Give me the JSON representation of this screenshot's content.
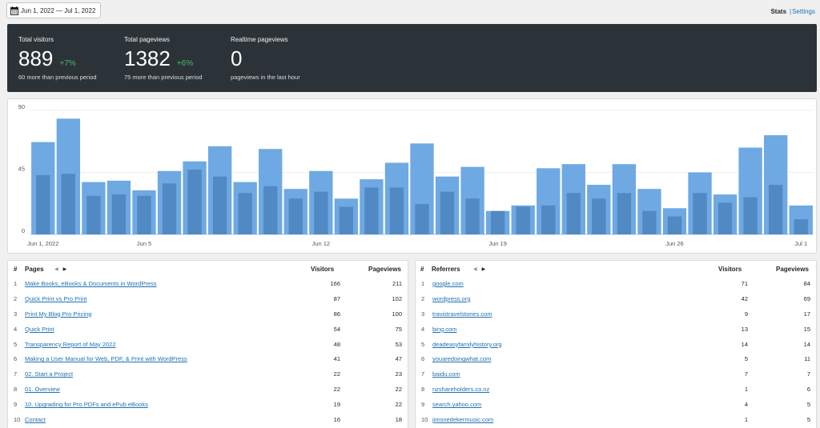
{
  "date_range": "Jun 1, 2022 — Jul 1, 2022",
  "nav": {
    "stats": "Stats",
    "separator": "|",
    "settings": "Settings"
  },
  "summary": {
    "total_visitors": {
      "label": "Total visitors",
      "value": "889",
      "change": "+7%",
      "sub": "60 more than previous period"
    },
    "total_pageviews": {
      "label": "Total pageviews",
      "value": "1382",
      "change": "+6%",
      "sub": "75 more than previous period"
    },
    "realtime": {
      "label": "Realtime pageviews",
      "value": "0",
      "sub": "pageviews in the last hour"
    }
  },
  "colors": {
    "pageviews_bar": "#6ea9e3",
    "visitors_bar": "#5089c4",
    "positive": "#4ab866",
    "link": "#2271b1",
    "dark_panel": "#2c3338"
  },
  "chart_data": {
    "type": "bar",
    "title": "",
    "xlabel": "",
    "ylabel": "",
    "ylim": [
      0,
      90
    ],
    "y_ticks": [
      "0",
      "45",
      "90"
    ],
    "x_tick_labels": [
      {
        "index": 0,
        "label": "Jun 1, 2022"
      },
      {
        "index": 4,
        "label": "Jun 5"
      },
      {
        "index": 11,
        "label": "Jun 12"
      },
      {
        "index": 18,
        "label": "Jun 19"
      },
      {
        "index": 25,
        "label": "Jun 26"
      },
      {
        "index": 30,
        "label": "Jul 1"
      }
    ],
    "grid": true,
    "series": [
      {
        "values": [
          67,
          84,
          38,
          39,
          32,
          46,
          53,
          64,
          38,
          62,
          33,
          46,
          26,
          40,
          52,
          66,
          42,
          49,
          17,
          21,
          48,
          51,
          36,
          51,
          33,
          19,
          45,
          29,
          63,
          72,
          21
        ]
      },
      {
        "values": [
          43,
          44,
          28,
          29,
          28,
          37,
          47,
          42,
          30,
          35,
          26,
          31,
          20,
          34,
          34,
          22,
          31,
          26,
          17,
          20,
          21,
          30,
          26,
          30,
          17,
          13,
          30,
          23,
          27,
          36,
          11
        ]
      }
    ]
  },
  "pages": {
    "col_num": "#",
    "title": "Pages",
    "prev_arrow": "◀",
    "next_arrow": "▶",
    "col_visitors": "Visitors",
    "col_pageviews": "Pageviews",
    "rows": [
      {
        "n": "1",
        "name": "Make Books, eBooks & Documents in WordPress",
        "visitors": "166",
        "pageviews": "211"
      },
      {
        "n": "2",
        "name": "Quick Print vs Pro Print",
        "visitors": "87",
        "pageviews": "102"
      },
      {
        "n": "3",
        "name": "Print My Blog Pro Pricing",
        "visitors": "86",
        "pageviews": "100"
      },
      {
        "n": "4",
        "name": "Quick Print",
        "visitors": "54",
        "pageviews": "75"
      },
      {
        "n": "5",
        "name": "Transparency Report of May 2022",
        "visitors": "48",
        "pageviews": "53"
      },
      {
        "n": "6",
        "name": "Making a User Manual for Web, PDF, & Print with WordPress",
        "visitors": "41",
        "pageviews": "47"
      },
      {
        "n": "7",
        "name": "02. Start a Project",
        "visitors": "22",
        "pageviews": "23"
      },
      {
        "n": "8",
        "name": "01. Overview",
        "visitors": "22",
        "pageviews": "22"
      },
      {
        "n": "9",
        "name": "10. Upgrading for Pro PDFs and ePub eBooks",
        "visitors": "19",
        "pageviews": "22"
      },
      {
        "n": "10",
        "name": "Contact",
        "visitors": "16",
        "pageviews": "18"
      }
    ]
  },
  "referrers": {
    "col_num": "#",
    "title": "Referrers",
    "prev_arrow": "◀",
    "next_arrow": "▶",
    "col_visitors": "Visitors",
    "col_pageviews": "Pageviews",
    "rows": [
      {
        "n": "1",
        "name": "google.com",
        "visitors": "71",
        "pageviews": "84"
      },
      {
        "n": "2",
        "name": "wordpress.org",
        "visitors": "42",
        "pageviews": "69"
      },
      {
        "n": "3",
        "name": "travistravelstories.com",
        "visitors": "9",
        "pageviews": "17"
      },
      {
        "n": "4",
        "name": "bing.com",
        "visitors": "13",
        "pageviews": "15"
      },
      {
        "n": "5",
        "name": "deadeasyfamilyhistory.org",
        "visitors": "14",
        "pageviews": "14"
      },
      {
        "n": "6",
        "name": "youaredoingwhat.com",
        "visitors": "5",
        "pageviews": "11"
      },
      {
        "n": "7",
        "name": "baidu.com",
        "visitors": "7",
        "pageviews": "7"
      },
      {
        "n": "8",
        "name": "nzshareholders.co.nz",
        "visitors": "1",
        "pageviews": "6"
      },
      {
        "n": "9",
        "name": "search.yahoo.com",
        "visitors": "4",
        "pageviews": "5"
      },
      {
        "n": "10",
        "name": "jimsnedekermusic.com",
        "visitors": "1",
        "pageviews": "5"
      }
    ]
  }
}
